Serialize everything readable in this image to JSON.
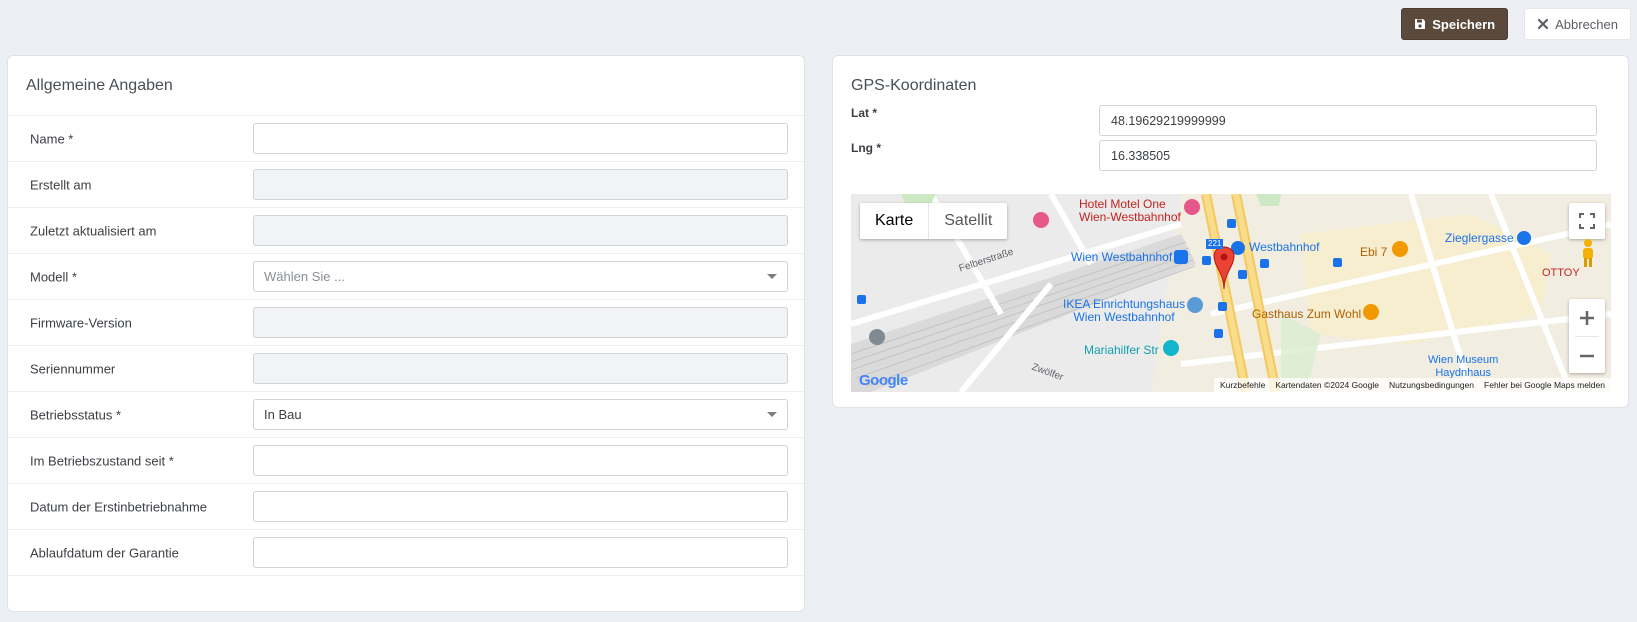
{
  "toolbar": {
    "save_label": "Speichern",
    "cancel_label": "Abbrechen",
    "save_color": "#5b4a3c"
  },
  "general": {
    "title": "Allgemeine Angaben",
    "fields": [
      {
        "label": "Name *",
        "value": "",
        "type": "text"
      },
      {
        "label": "Erstellt am",
        "value": "",
        "type": "disabled"
      },
      {
        "label": "Zuletzt aktualisiert am",
        "value": "",
        "type": "disabled"
      },
      {
        "label": "Modell *",
        "placeholder": "Wählen Sie ...",
        "type": "select"
      },
      {
        "label": "Firmware-Version",
        "value": "",
        "type": "disabled"
      },
      {
        "label": "Seriennummer",
        "value": "",
        "type": "disabled"
      },
      {
        "label": "Betriebsstatus *",
        "value": "In Bau",
        "type": "select"
      },
      {
        "label": "Im Betriebszustand seit *",
        "value": "",
        "type": "text"
      },
      {
        "label": "Datum der Erstinbetriebnahme",
        "value": "",
        "type": "text"
      },
      {
        "label": "Ablaufdatum der Garantie",
        "value": "",
        "type": "text"
      }
    ]
  },
  "gps": {
    "title": "GPS-Koordinaten",
    "lat_label": "Lat *",
    "lat_value": "48.19629219999999",
    "lng_label": "Lng *",
    "lng_value": "16.338505"
  },
  "map": {
    "type_map": "Karte",
    "type_satellite": "Satellit",
    "logo": "Google",
    "attribution": {
      "shortcuts": "Kurzbefehle",
      "data": "Kartendaten ©2024 Google",
      "terms": "Nutzungsbedingungen",
      "report": "Fehler bei Google Maps melden"
    },
    "labels": {
      "hotel": "Hotel Motel One\nWien-Westbahnhof",
      "station": "Wien Westbahnhof",
      "westbahnhof_u": "Westbahnhof",
      "ikea": "IKEA Einrichtungshaus\nWien Westbahnhof",
      "mariahilfer": "Mariahilfer Str",
      "gasthaus": "Gasthaus Zum Wohl",
      "ebi": "Ebi 7",
      "zieglergasse": "Zieglergasse",
      "ottoy": "OTTOY",
      "museum": "Wien Museum\nHaydnhaus",
      "felberstrasse": "Felberstraße",
      "zwoelfer": "Zwölfer",
      "line_badge": "221"
    }
  }
}
